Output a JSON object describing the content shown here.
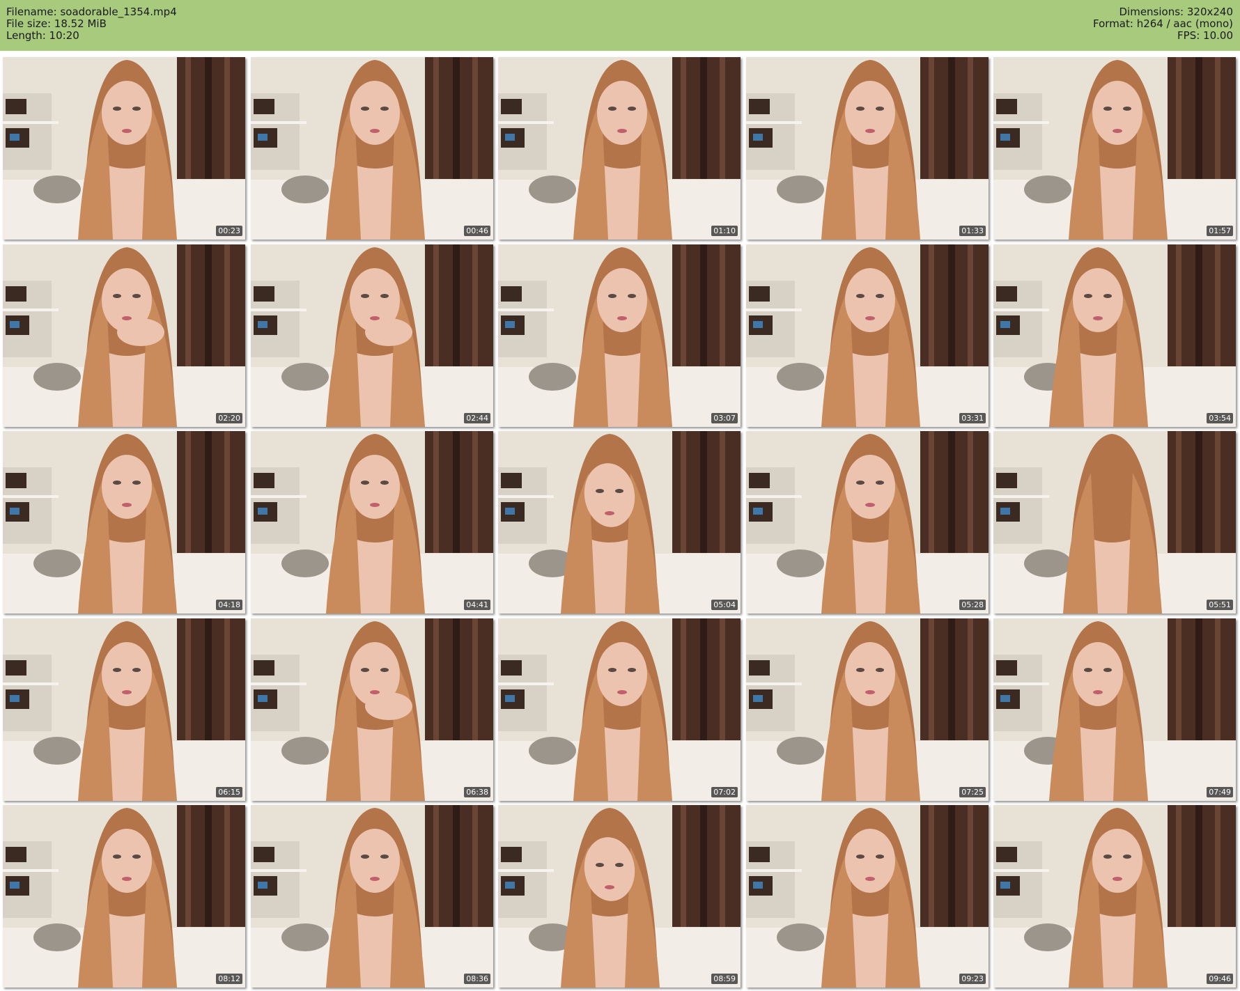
{
  "header": {
    "filename": "Filename: soadorable_1354.mp4",
    "filesize": "File size: 18.52 MiB",
    "length": "Length: 10:20",
    "dimensions": "Dimensions: 320x240",
    "format": "Format: h264 / aac (mono)",
    "fps": "FPS: 10.00"
  },
  "colors": {
    "header_bg": "#a8ca7c",
    "wall": "#e8e2d6",
    "curtain": "#4a2e24",
    "shelf": "#3b2a22",
    "sofa": "#f2ede6",
    "pillow": "#9c958c",
    "hair": "#b4744a",
    "skin": "#ecc3ae"
  },
  "thumbnails": [
    {
      "time": "00:23",
      "pose": "center"
    },
    {
      "time": "00:46",
      "pose": "center"
    },
    {
      "time": "01:10",
      "pose": "center"
    },
    {
      "time": "01:33",
      "pose": "center"
    },
    {
      "time": "01:57",
      "pose": "center"
    },
    {
      "time": "02:20",
      "pose": "hand"
    },
    {
      "time": "02:44",
      "pose": "hand"
    },
    {
      "time": "03:07",
      "pose": "center"
    },
    {
      "time": "03:31",
      "pose": "center"
    },
    {
      "time": "03:54",
      "pose": "side"
    },
    {
      "time": "04:18",
      "pose": "center"
    },
    {
      "time": "04:41",
      "pose": "center"
    },
    {
      "time": "05:04",
      "pose": "down"
    },
    {
      "time": "05:28",
      "pose": "center"
    },
    {
      "time": "05:51",
      "pose": "back"
    },
    {
      "time": "06:15",
      "pose": "center"
    },
    {
      "time": "06:38",
      "pose": "hand"
    },
    {
      "time": "07:02",
      "pose": "center"
    },
    {
      "time": "07:25",
      "pose": "center"
    },
    {
      "time": "07:49",
      "pose": "side"
    },
    {
      "time": "08:12",
      "pose": "center"
    },
    {
      "time": "08:36",
      "pose": "center"
    },
    {
      "time": "08:59",
      "pose": "down"
    },
    {
      "time": "09:23",
      "pose": "center"
    },
    {
      "time": "09:46",
      "pose": "center"
    }
  ]
}
